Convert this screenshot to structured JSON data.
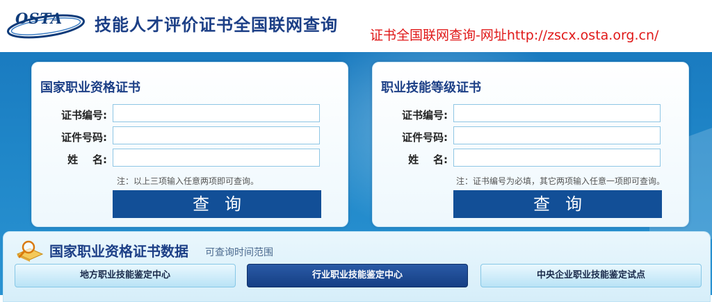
{
  "header": {
    "logo_text": "OSTA",
    "title": "技能人才评价证书全国联网查询",
    "url_note": "证书全国联网查询-网址http://zscx.osta.org.cn/"
  },
  "left_card": {
    "title": "国家职业资格证书",
    "fields": [
      {
        "label": "证书编号:",
        "value": ""
      },
      {
        "label": "证件号码:",
        "value": ""
      },
      {
        "label": "姓    名:",
        "value": ""
      }
    ],
    "note": "注：以上三项输入任意两项即可查询。",
    "button": "查询"
  },
  "right_card": {
    "title": "职业技能等级证书",
    "fields": [
      {
        "label": "证书编号:",
        "value": ""
      },
      {
        "label": "证件号码:",
        "value": ""
      },
      {
        "label": "姓    名:",
        "value": ""
      }
    ],
    "note": "注：证书编号为必填，其它两项输入任意一项即可查询。",
    "button": "查询"
  },
  "data_panel": {
    "icon": "magnifier-book-icon",
    "title": "国家职业资格证书数据",
    "subtitle": "可查询时间范围",
    "tabs": [
      {
        "label": "地方职业技能鉴定中心",
        "active": false
      },
      {
        "label": "行业职业技能鉴定中心",
        "active": true
      },
      {
        "label": "中央企业职业技能鉴定试点",
        "active": false
      }
    ]
  },
  "colors": {
    "brand_blue": "#1c3f86",
    "button_blue": "#124f97",
    "band_blue": "#1f86c8",
    "url_red": "#e01818"
  }
}
